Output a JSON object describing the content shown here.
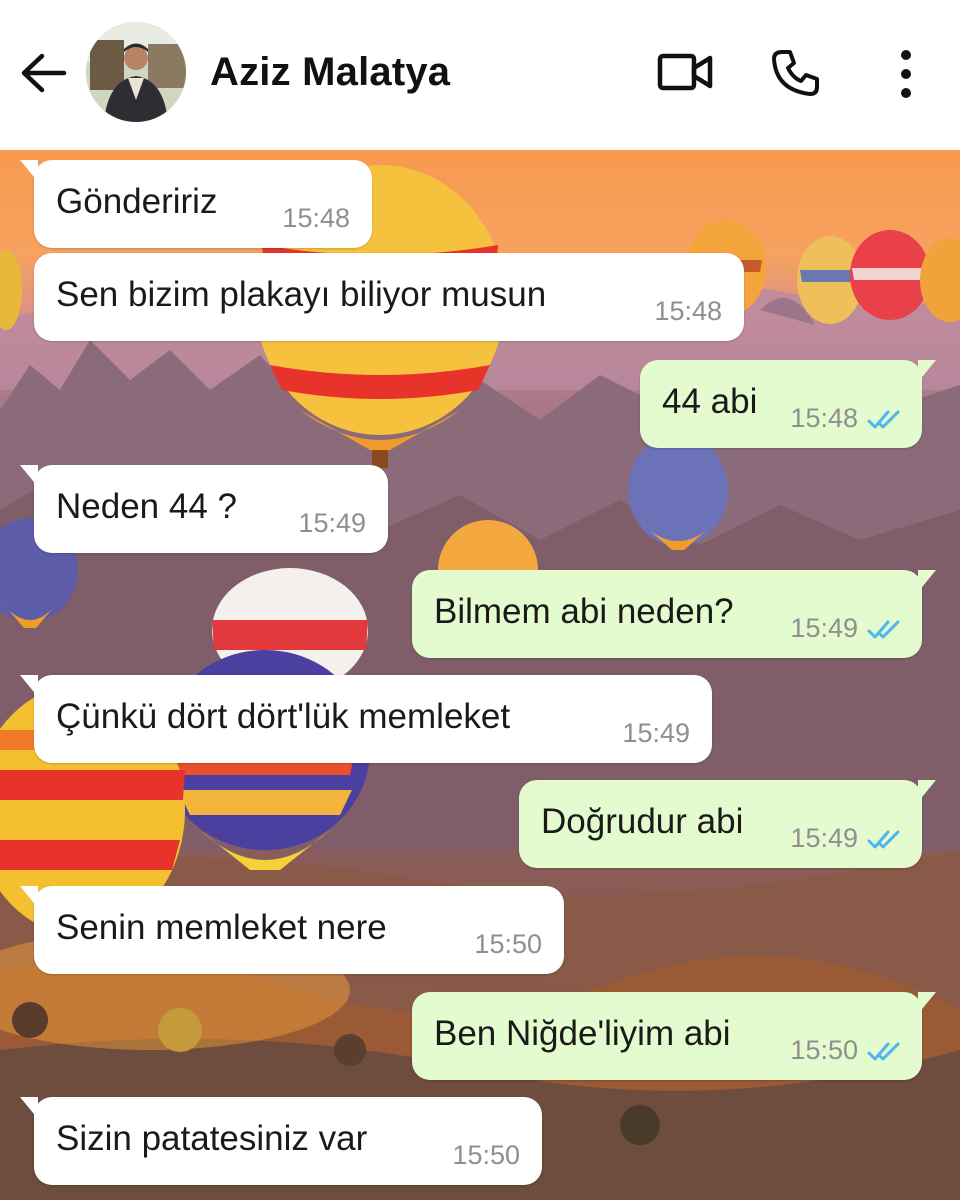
{
  "header": {
    "contact_name": "Aziz Malatya",
    "icons": {
      "back": "arrow-left-icon",
      "video": "video-camera-icon",
      "call": "phone-icon",
      "menu": "more-vertical-icon"
    }
  },
  "messages": [
    {
      "direction": "in",
      "text": "Göndeririz",
      "time": "15:48"
    },
    {
      "direction": "in",
      "text": "Sen bizim plakayı biliyor musun",
      "time": "15:48"
    },
    {
      "direction": "out",
      "text": "44 abi",
      "time": "15:48",
      "status": "read"
    },
    {
      "direction": "in",
      "text": "Neden 44 ?",
      "time": "15:49"
    },
    {
      "direction": "out",
      "text": "Bilmem abi neden?",
      "time": "15:49",
      "status": "read"
    },
    {
      "direction": "in",
      "text": "Çünkü dört dört'lük memleket",
      "time": "15:49"
    },
    {
      "direction": "out",
      "text": "Doğrudur abi",
      "time": "15:49",
      "status": "read"
    },
    {
      "direction": "in",
      "text": "Senin memleket nere",
      "time": "15:50"
    },
    {
      "direction": "out",
      "text": "Ben Niğde'liyim abi",
      "time": "15:50",
      "status": "read"
    },
    {
      "direction": "in",
      "text": "Sizin patatesiniz var",
      "time": "15:50"
    }
  ],
  "colors": {
    "incoming_bubble": "#ffffff",
    "outgoing_bubble": "#e4fbcf",
    "read_ticks": "#4fb6ec",
    "timestamp": "#8f8f8f"
  }
}
